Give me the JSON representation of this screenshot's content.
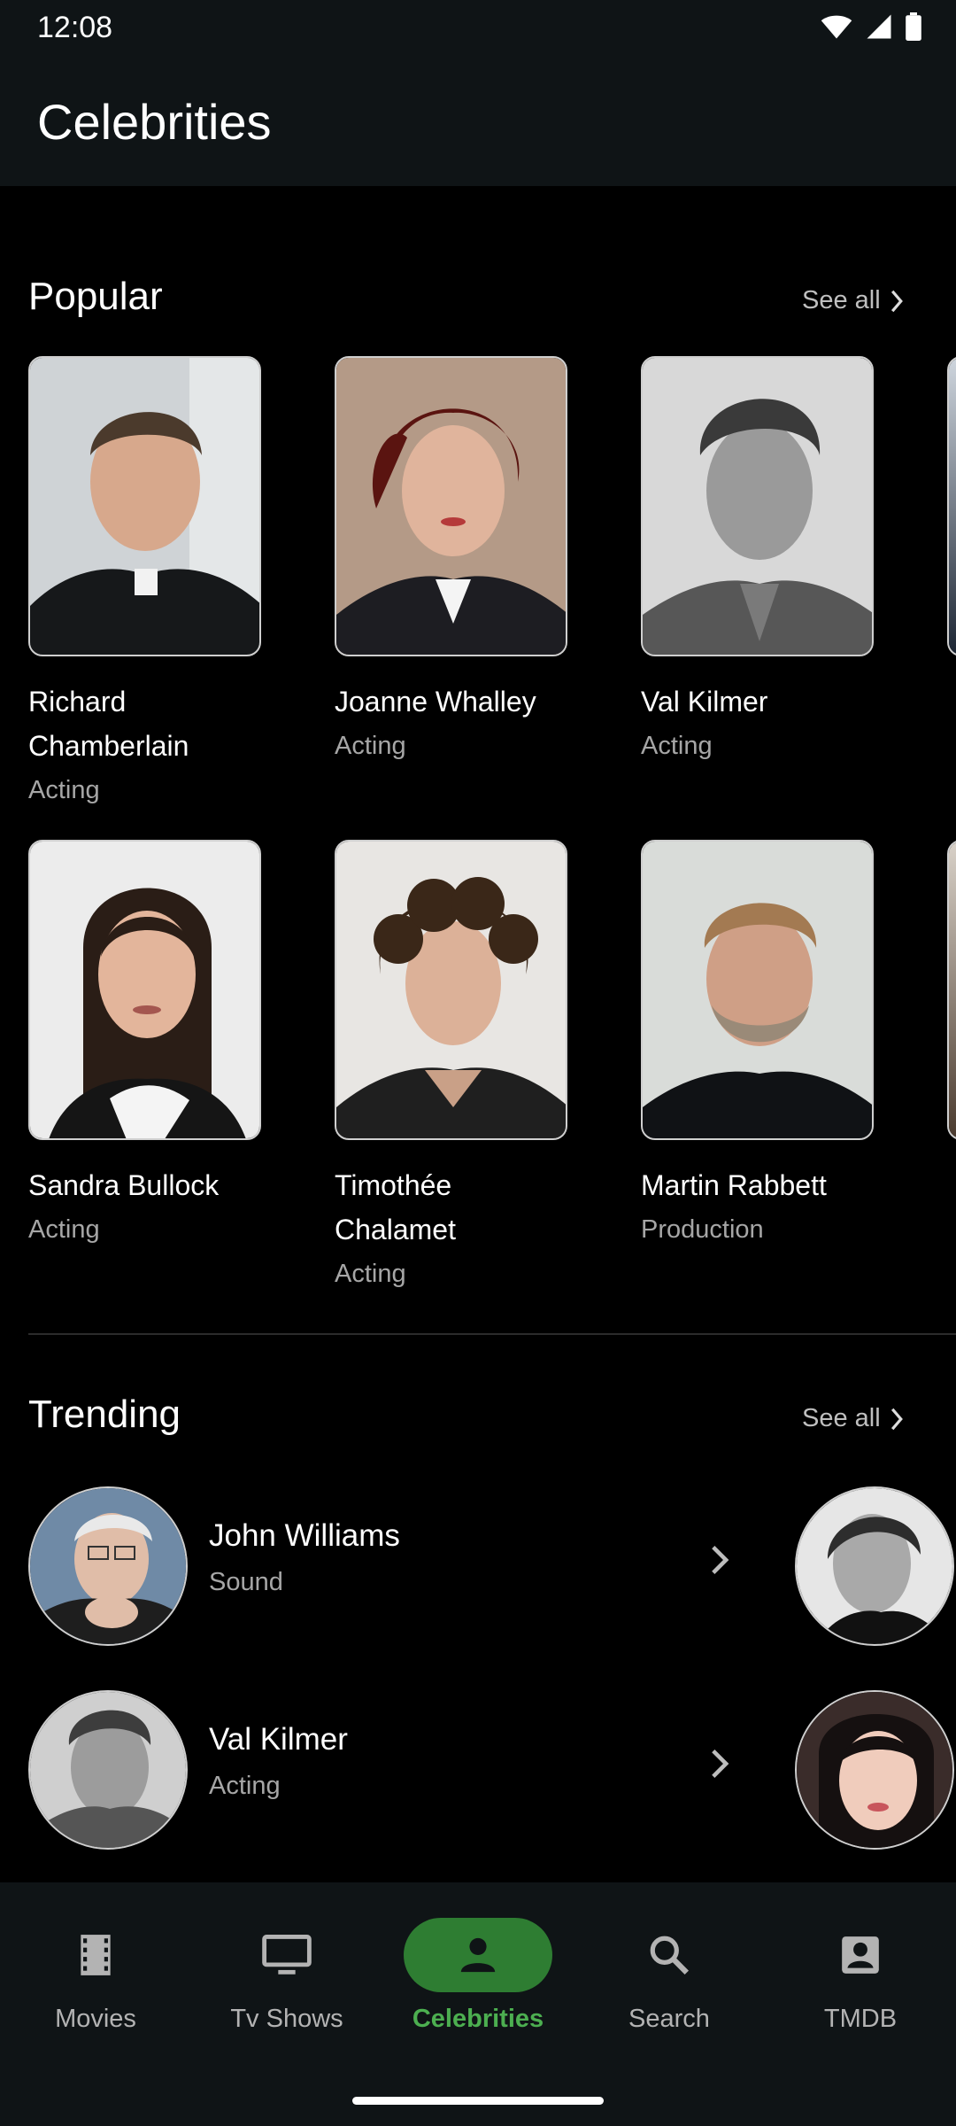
{
  "status": {
    "time": "12:08"
  },
  "app_title": "Celebrities",
  "popular": {
    "title": "Popular",
    "see_all": "See all",
    "people": [
      {
        "name": "Richard Chamberlain",
        "role": "Acting"
      },
      {
        "name": "Joanne Whalley",
        "role": "Acting"
      },
      {
        "name": "Val Kilmer",
        "role": "Acting"
      },
      {
        "name": "Sandra Bullock",
        "role": "Acting"
      },
      {
        "name": "Timothée Chalamet",
        "role": "Acting"
      },
      {
        "name": "Martin Rabbett",
        "role": "Production"
      }
    ]
  },
  "trending": {
    "title": "Trending",
    "see_all": "See all",
    "people": [
      {
        "name": "John Williams",
        "role": "Sound"
      },
      {
        "name": "Val Kilmer",
        "role": "Acting"
      }
    ]
  },
  "nav": {
    "items": [
      {
        "label": "Movies",
        "icon": "film-icon"
      },
      {
        "label": "Tv Shows",
        "icon": "tv-icon"
      },
      {
        "label": "Celebrities",
        "icon": "person-icon"
      },
      {
        "label": "Search",
        "icon": "search-icon"
      },
      {
        "label": "TMDB",
        "icon": "account-box-icon"
      }
    ],
    "active": "Celebrities"
  },
  "colors": {
    "bar_background": "#0f1416",
    "page_background": "#000000",
    "accent": "#4caf50",
    "active_pill": "#2e7d32"
  }
}
